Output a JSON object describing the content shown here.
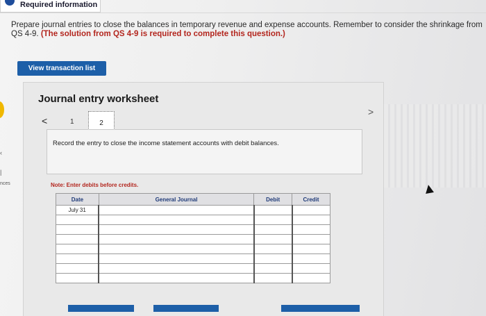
{
  "header": {
    "required_label": "Required information"
  },
  "instructions": {
    "text": "Prepare journal entries to close the balances in temporary revenue and expense accounts. Remember to consider the shrinkage from QS 4-9. ",
    "emphasis": "(The solution from QS 4-9 is required to complete this question.)"
  },
  "buttons": {
    "view_transaction_list": "View transaction list"
  },
  "side": {
    "partial_text": "nces"
  },
  "worksheet": {
    "title": "Journal entry worksheet",
    "nav": {
      "prev": "<",
      "page1": "1",
      "page2": "2",
      "next": ">"
    },
    "prompt": "Record the entry to close the income statement accounts with debit balances.",
    "note": "Note: Enter debits before credits."
  },
  "table": {
    "headers": {
      "date": "Date",
      "general_journal": "General Journal",
      "debit": "Debit",
      "credit": "Credit"
    },
    "rows": [
      {
        "date": "July 31"
      },
      {
        "date": ""
      },
      {
        "date": ""
      },
      {
        "date": ""
      },
      {
        "date": ""
      },
      {
        "date": ""
      },
      {
        "date": ""
      },
      {
        "date": ""
      }
    ]
  }
}
